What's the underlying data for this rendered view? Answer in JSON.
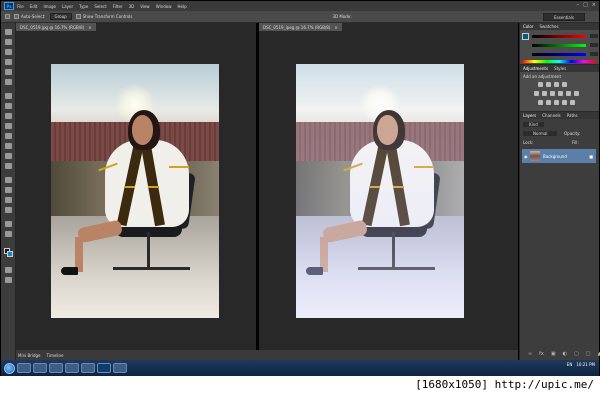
{
  "app": {
    "logo_text": "Ps"
  },
  "menu": [
    "File",
    "Edit",
    "Image",
    "Layer",
    "Type",
    "Select",
    "Filter",
    "3D",
    "View",
    "Window",
    "Help"
  ],
  "options": {
    "auto_select": "Auto-Select:",
    "layer_mode": "Group",
    "transform": "Show Transform Controls",
    "mode_3d": "3D Mode:",
    "workspace": "Essentials"
  },
  "documents": [
    {
      "tab": "DSC_0519.jpg @ 16.7% (RGB/8)",
      "zoom": "16.67%",
      "doc_size": "Doc: 34.9M/34.9M"
    },
    {
      "tab": "DSC_0519_ipeg @ 16.7% (RGB/8)",
      "zoom": "16.67%",
      "doc_size": "Doc: 34.9M/34.9M"
    }
  ],
  "color_panel": {
    "tabs": [
      "Color",
      "Swatches"
    ],
    "r": "0",
    "g": "91",
    "b": "129"
  },
  "adjustments_panel": {
    "tabs": [
      "Adjustments",
      "Styles"
    ],
    "heading": "Add an adjustment"
  },
  "layers_panel": {
    "tabs": [
      "Layers",
      "Channels",
      "Paths"
    ],
    "kind": "Kind",
    "blend": "Normal",
    "opacity": "Opacity:",
    "fill": "Fill:",
    "lock": "Lock:",
    "layer_name": "Background"
  },
  "bottom_tabs": [
    "Mini Bridge",
    "Timeline"
  ],
  "taskbar": {
    "lang": "EN",
    "time": "10:21 PM"
  },
  "watermark": "[1680x1050] http://upic.me/",
  "colors": {
    "accent": "#31a8ff",
    "foreground_swatch": "#1a1a1a",
    "background_swatch": "#0a8bc9"
  }
}
